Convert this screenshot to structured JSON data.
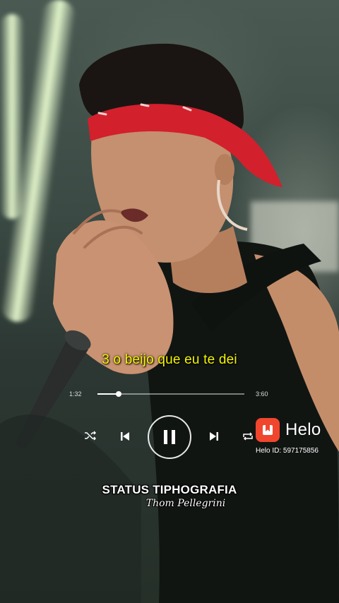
{
  "lyric": "3 o beijo que eu te dei",
  "player": {
    "current_time": "1:32",
    "total_time": "3:60",
    "progress": 0.145,
    "state": "playing",
    "icons": [
      "shuffle-icon",
      "previous-icon",
      "pause-icon",
      "next-icon",
      "repeat-icon"
    ]
  },
  "watermark": {
    "brand": "Helo",
    "user_id": "Helo ID: 597175856",
    "logo_color": "#f0462e"
  },
  "credit": {
    "line1": "STATUS TIPHOGRAFIA",
    "line2": "Thom Pellegrini"
  },
  "colors": {
    "lyric": "#f5f500",
    "headband": "#d2202d"
  }
}
